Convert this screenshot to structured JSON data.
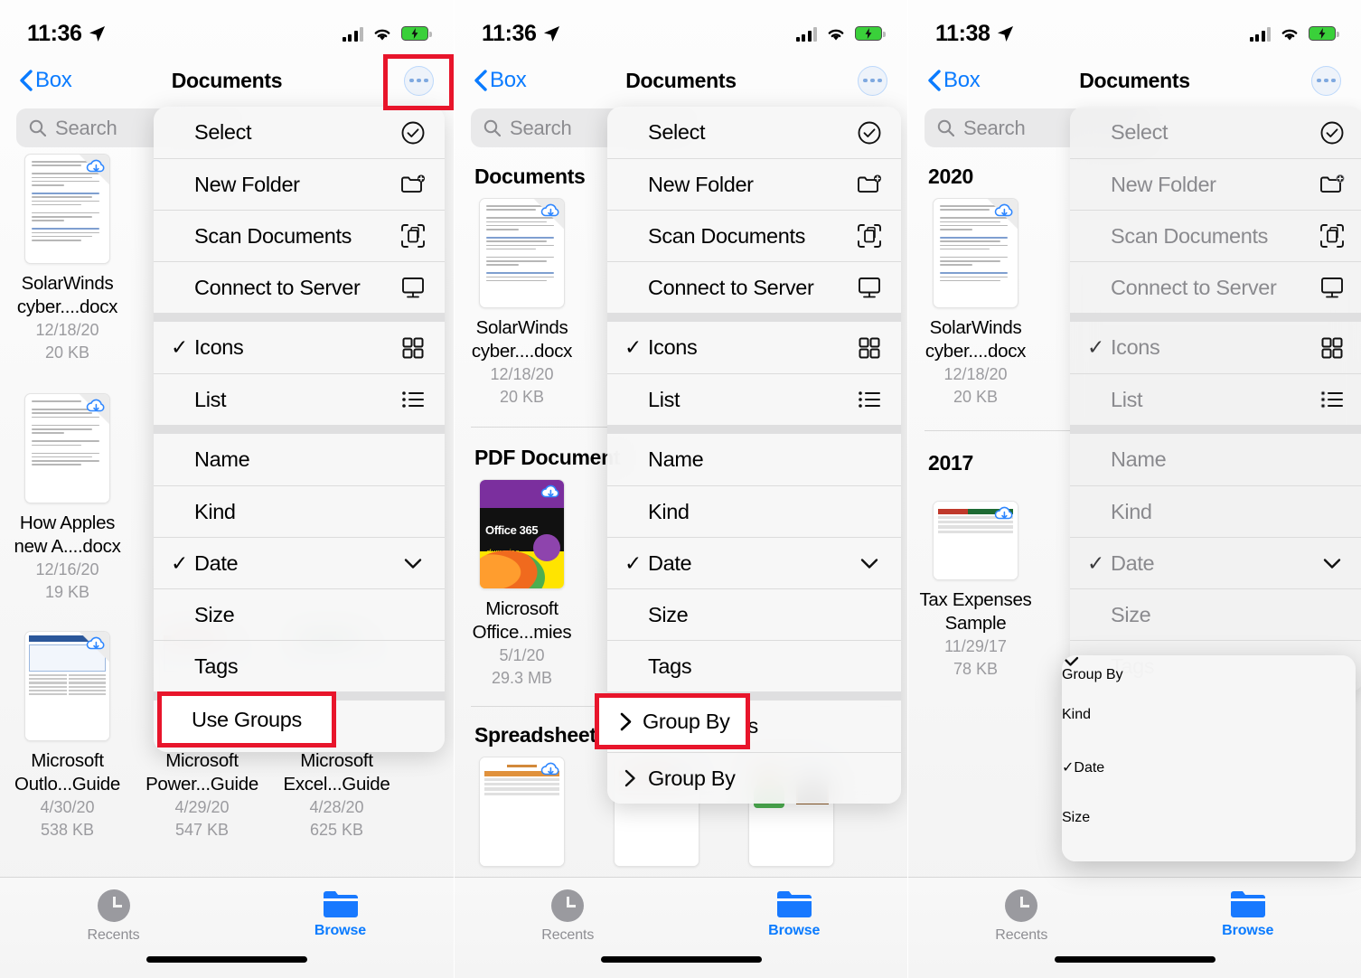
{
  "panels": [
    {
      "id": "panel-1",
      "status": {
        "time": "11:36",
        "location_icon": "location-arrow-icon",
        "cellular_icon": "cellular-signal-icon",
        "wifi_icon": "wifi-icon",
        "battery_icon": "battery-charging-icon"
      },
      "nav": {
        "back_label": "Box",
        "title": "Documents",
        "more_icon": "ellipsis-circle-icon"
      },
      "search": {
        "placeholder": "Search",
        "icon": "magnifier-icon"
      },
      "section_title": "",
      "files": [
        {
          "name": "SolarWinds cyber....docx",
          "date": "12/18/20",
          "size": "20 KB",
          "thumb": "document",
          "cloud": true
        },
        {
          "name": "How Apples new A....docx",
          "date": "12/16/20",
          "size": "19 KB",
          "thumb": "document",
          "cloud": true
        },
        {
          "name": "Microsoft Outlo...Guide",
          "date": "4/30/20",
          "size": "538 KB",
          "thumb": "guide",
          "cloud": true
        },
        {
          "name": "Microsoft Power...Guide",
          "date": "4/29/20",
          "size": "547 KB",
          "thumb": "guide",
          "cloud": true
        },
        {
          "name": "Microsoft Excel...Guide",
          "date": "4/28/20",
          "size": "625 KB",
          "thumb": "guide",
          "cloud": true
        }
      ],
      "menu": {
        "dimmed": false,
        "items": [
          {
            "label": "Select",
            "icon": "checkmark-circle-icon",
            "checked": false
          },
          {
            "label": "New Folder",
            "icon": "folder-plus-icon",
            "checked": false
          },
          {
            "label": "Scan Documents",
            "icon": "scan-document-icon",
            "checked": false
          },
          {
            "label": "Connect to Server",
            "icon": "display-icon",
            "checked": false
          },
          {
            "separator": true
          },
          {
            "label": "Icons",
            "icon": "grid-icon",
            "checked": true
          },
          {
            "label": "List",
            "icon": "list-bullet-icon",
            "checked": false
          },
          {
            "separator": true
          },
          {
            "label": "Name",
            "icon": "",
            "checked": false
          },
          {
            "label": "Kind",
            "icon": "",
            "checked": false
          },
          {
            "label": "Date",
            "icon": "chevron-down-icon",
            "checked": true
          },
          {
            "label": "Size",
            "icon": "",
            "checked": false
          },
          {
            "label": "Tags",
            "icon": "",
            "checked": false
          },
          {
            "separator": true
          },
          {
            "label": "Use Groups",
            "icon": "",
            "checked": false
          }
        ]
      },
      "highlights": [
        {
          "name": "more-button-highlight",
          "target": "ellipsis-circle-icon"
        },
        {
          "name": "use-groups-highlight",
          "target": "Use Groups"
        }
      ],
      "tabs": [
        {
          "label": "Recents",
          "icon": "clock-icon",
          "active": false
        },
        {
          "label": "Browse",
          "icon": "folder-icon",
          "active": true
        }
      ]
    },
    {
      "id": "panel-2",
      "status": {
        "time": "11:36"
      },
      "nav": {
        "back_label": "Box",
        "title": "Documents"
      },
      "search": {
        "placeholder": "Search"
      },
      "groups": [
        {
          "heading": "Documents",
          "files": [
            {
              "name": "SolarWinds cyber....docx",
              "date": "12/18/20",
              "size": "20 KB",
              "thumb": "document"
            }
          ]
        },
        {
          "heading": "PDF Document",
          "files": [
            {
              "name": "Microsoft Office...mies",
              "date": "5/1/20",
              "size": "29.3 MB",
              "thumb": "book"
            }
          ]
        },
        {
          "heading": "Spreadsheets",
          "files": [
            {
              "name": "",
              "date": "",
              "size": "",
              "thumb": "sheet-orange"
            },
            {
              "name": "",
              "date": "",
              "size": "",
              "thumb": "sheet-red"
            },
            {
              "name": "",
              "date": "",
              "size": "",
              "thumb": "planner"
            }
          ]
        }
      ],
      "menu": {
        "dimmed": false,
        "items": [
          {
            "label": "Select",
            "icon": "checkmark-circle-icon",
            "checked": false
          },
          {
            "label": "New Folder",
            "icon": "folder-plus-icon",
            "checked": false
          },
          {
            "label": "Scan Documents",
            "icon": "scan-document-icon",
            "checked": false
          },
          {
            "label": "Connect to Server",
            "icon": "display-icon",
            "checked": false
          },
          {
            "separator": true
          },
          {
            "label": "Icons",
            "icon": "grid-icon",
            "checked": true
          },
          {
            "label": "List",
            "icon": "list-bullet-icon",
            "checked": false
          },
          {
            "separator": true
          },
          {
            "label": "Name",
            "icon": "",
            "checked": false
          },
          {
            "label": "Kind",
            "icon": "",
            "checked": false
          },
          {
            "label": "Date",
            "icon": "chevron-down-icon",
            "checked": true
          },
          {
            "label": "Size",
            "icon": "",
            "checked": false
          },
          {
            "label": "Tags",
            "icon": "",
            "checked": false
          },
          {
            "separator": true
          },
          {
            "label": "Use Groups",
            "icon": "",
            "checked": true
          },
          {
            "label": "Group By",
            "icon": "",
            "checked": false,
            "expand": "chevron-right-icon"
          }
        ]
      },
      "highlights": [
        {
          "name": "group-by-highlight",
          "target": "Group By"
        }
      ],
      "tabs": [
        {
          "label": "Recents",
          "icon": "clock-icon",
          "active": false
        },
        {
          "label": "Browse",
          "icon": "folder-icon",
          "active": true
        }
      ]
    },
    {
      "id": "panel-3",
      "status": {
        "time": "11:38"
      },
      "nav": {
        "back_label": "Box",
        "title": "Documents"
      },
      "search": {
        "placeholder": "Search"
      },
      "groups": [
        {
          "heading": "2020",
          "files": [
            {
              "name": "SolarWinds cyber....docx",
              "date": "12/18/20",
              "size": "20 KB",
              "thumb": "document"
            }
          ]
        },
        {
          "heading": "2017",
          "files": [
            {
              "name": "Tax Expenses Sample",
              "date": "11/29/17",
              "size": "78 KB",
              "thumb": "sheet-red"
            }
          ]
        }
      ],
      "menu": {
        "dimmed": true,
        "items": [
          {
            "label": "Select",
            "icon": "checkmark-circle-icon",
            "checked": false
          },
          {
            "label": "New Folder",
            "icon": "folder-plus-icon",
            "checked": false
          },
          {
            "label": "Scan Documents",
            "icon": "scan-document-icon",
            "checked": false
          },
          {
            "label": "Connect to Server",
            "icon": "display-icon",
            "checked": false
          },
          {
            "separator": true
          },
          {
            "label": "Icons",
            "icon": "grid-icon",
            "checked": true
          },
          {
            "label": "List",
            "icon": "list-bullet-icon",
            "checked": false
          },
          {
            "separator": true
          },
          {
            "label": "Name",
            "icon": "",
            "checked": false
          },
          {
            "label": "Kind",
            "icon": "",
            "checked": false
          },
          {
            "label": "Date",
            "icon": "chevron-down-icon",
            "checked": true
          },
          {
            "label": "Size",
            "icon": "",
            "checked": false
          },
          {
            "label": "Tags",
            "icon": "",
            "checked": false
          }
        ]
      },
      "submenu": {
        "items": [
          {
            "label": "Group By",
            "icon": "chevron-down-icon",
            "checked": false,
            "bold": true
          },
          {
            "label": "Kind",
            "icon": "",
            "checked": false
          },
          {
            "label": "Date",
            "icon": "",
            "checked": true
          },
          {
            "label": "Size",
            "icon": "",
            "checked": false
          }
        ]
      },
      "tabs": [
        {
          "label": "Recents",
          "icon": "clock-icon",
          "active": false
        },
        {
          "label": "Browse",
          "icon": "folder-icon",
          "active": true
        }
      ]
    }
  ],
  "colors": {
    "accent_blue": "#0a7bff",
    "highlight_red": "#e8152b",
    "menu_bg": "#f6f6f6",
    "meta_gray": "#9b9b9f",
    "battery_green": "#3ad03a"
  }
}
